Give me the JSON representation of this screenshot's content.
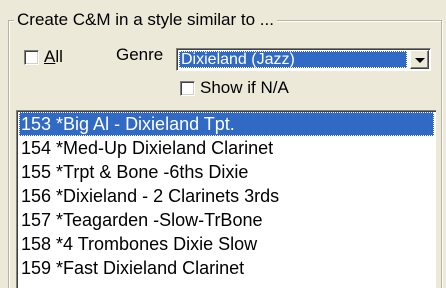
{
  "group": {
    "title": "Create C&M in a style similar to ..."
  },
  "filters": {
    "all_label_accel": "A",
    "all_label_rest": "ll",
    "all_checked": false,
    "genre_label": "Genre",
    "genre_value": "Dixieland (Jazz)",
    "show_na_label": "Show if N/A",
    "show_na_checked": false
  },
  "styles": {
    "selected_index": 0,
    "items": [
      "153 *Big Al - Dixieland Tpt.",
      "154 *Med-Up Dixieland Clarinet",
      "155 *Trpt & Bone -6ths Dixie",
      "156 *Dixieland - 2 Clarinets 3rds",
      "157 *Teagarden -Slow-TrBone",
      "158 *4 Trombones Dixie Slow",
      "159 *Fast Dixieland Clarinet"
    ]
  },
  "colors": {
    "selection": "#316ac5",
    "dialog_bg": "#ece9d8"
  },
  "icons": {
    "combo_arrow": "chevron-down-icon"
  }
}
